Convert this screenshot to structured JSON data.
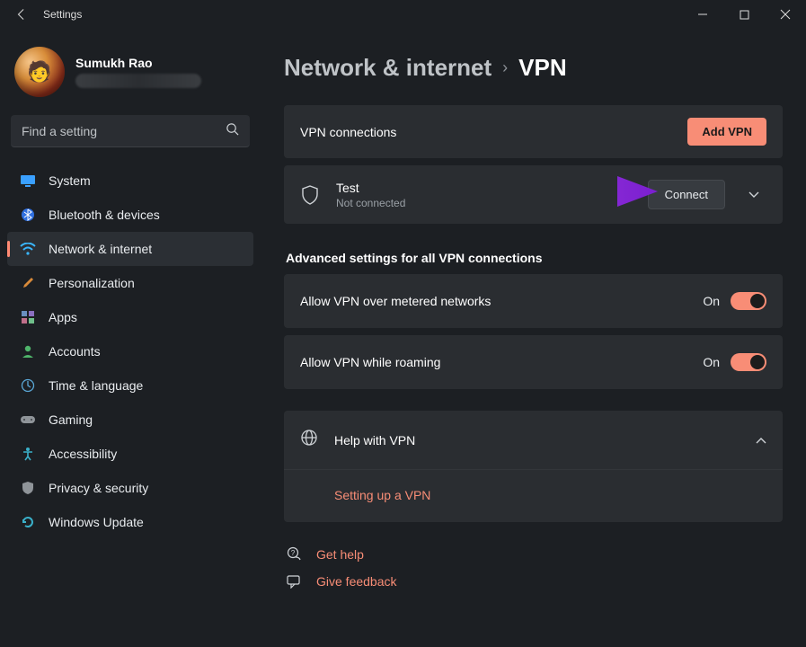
{
  "window": {
    "title": "Settings"
  },
  "profile": {
    "name": "Sumukh Rao"
  },
  "search": {
    "placeholder": "Find a setting"
  },
  "sidebar": {
    "items": [
      {
        "label": "System"
      },
      {
        "label": "Bluetooth & devices"
      },
      {
        "label": "Network & internet"
      },
      {
        "label": "Personalization"
      },
      {
        "label": "Apps"
      },
      {
        "label": "Accounts"
      },
      {
        "label": "Time & language"
      },
      {
        "label": "Gaming"
      },
      {
        "label": "Accessibility"
      },
      {
        "label": "Privacy & security"
      },
      {
        "label": "Windows Update"
      }
    ]
  },
  "breadcrumb": {
    "parent": "Network & internet",
    "current": "VPN"
  },
  "vpn_connections": {
    "heading": "VPN connections",
    "add_button": "Add VPN"
  },
  "vpn_item": {
    "name": "Test",
    "status": "Not connected",
    "connect_button": "Connect"
  },
  "advanced": {
    "heading": "Advanced settings for all VPN connections",
    "rows": [
      {
        "label": "Allow VPN over metered networks",
        "state": "On"
      },
      {
        "label": "Allow VPN while roaming",
        "state": "On"
      }
    ]
  },
  "help": {
    "title": "Help with VPN",
    "link": "Setting up a VPN"
  },
  "footer": {
    "get_help": "Get help",
    "give_feedback": "Give feedback"
  },
  "colors": {
    "accent": "#f88d76",
    "bg": "#1c1f23",
    "card": "#2a2d31"
  }
}
